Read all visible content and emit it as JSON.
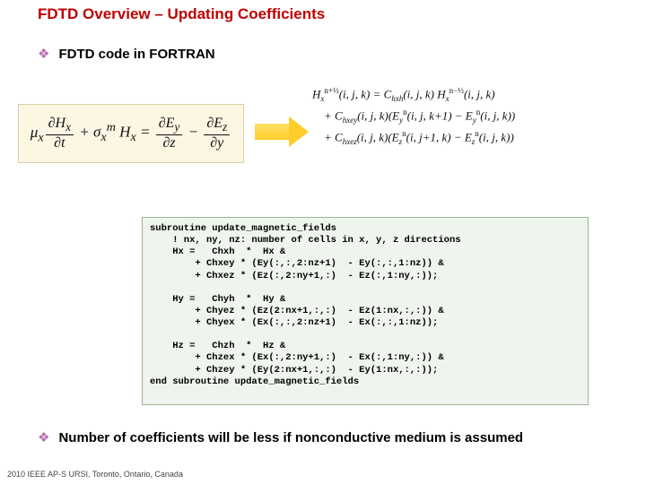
{
  "title": "FDTD Overview – Updating Coefficients",
  "bullets": {
    "first": "FDTD code in FORTRAN",
    "second": "Number of coefficients will be less if nonconductive medium is assumed"
  },
  "eq_left_html": "<span>μ<sub>x</sub></span><span class='frac'><span class='num'>∂H<sub>x</sub></span><span class='den'>∂t</span></span> + σ<sub>x</sub><sup>m</sup> H<sub>x</sub> = <span class='frac'><span class='num'>∂E<sub>y</sub></span><span class='den'>∂z</span></span> − <span class='frac'><span class='num'>∂E<sub>z</sub></span><span class='den'>∂y</span></span>",
  "eq_right_lines": [
    "H<sub>x</sub><sup>n+½</sup>(i, j, k) = C<sub>hxh</sub>(i, j, k) H<sub>x</sub><sup>n−½</sup>(i, j, k)",
    "&nbsp;&nbsp;&nbsp;&nbsp;+ C<sub>hxey</sub>(i, j, k)(E<sub>y</sub><sup>n</sup>(i, j, k+1) − E<sub>y</sub><sup>n</sup>(i, j, k))",
    "&nbsp;&nbsp;&nbsp;&nbsp;+ C<sub>hxez</sub>(i, j, k)(E<sub>z</sub><sup>n</sup>(i, j+1, k) − E<sub>z</sub><sup>n</sup>(i, j, k))"
  ],
  "code_lines": [
    "subroutine update_magnetic_fields",
    "    ! nx, ny, nz: number of cells in x, y, z directions",
    "    Hx =   Chxh  *  Hx &",
    "        + Chxey * (Ey(:,:,2:nz+1)  - Ey(:,:,1:nz)) &",
    "        + Chxez * (Ez(:,2:ny+1,:)  - Ez(:,1:ny,:));",
    "",
    "    Hy =   Chyh  *  Hy &",
    "        + Chyez * (Ez(2:nx+1,:,:)  - Ez(1:nx,:,:)) &",
    "        + Chyex * (Ex(:,:,2:nz+1)  - Ex(:,:,1:nz));",
    "",
    "    Hz =   Chzh  *  Hz &",
    "        + Chzex * (Ex(:,2:ny+1,:)  - Ex(:,1:ny,:)) &",
    "        + Chzey * (Ey(2:nx+1,:,:)  - Ey(1:nx,:,:));",
    "end subroutine update_magnetic_fields"
  ],
  "footer": "2010 IEEE AP-S URSI, Toronto, Ontario, Canada"
}
